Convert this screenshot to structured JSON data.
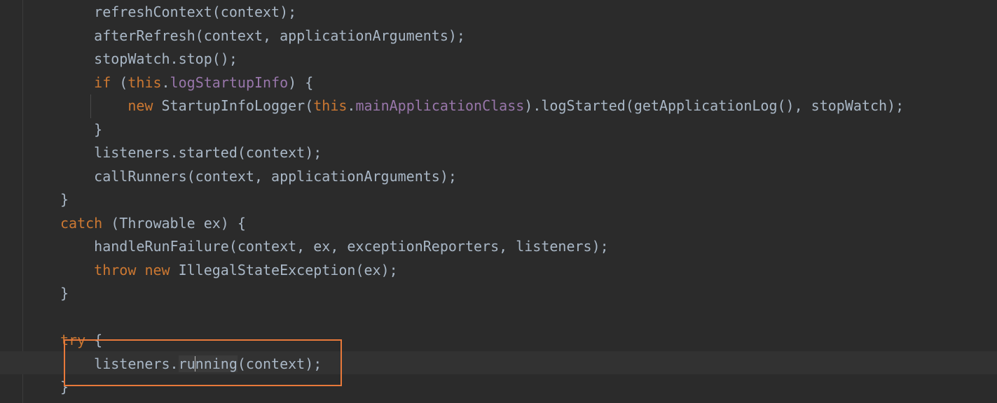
{
  "code": {
    "lines": [
      [
        {
          "t": "    refreshContext(context);",
          "c": "plain"
        }
      ],
      [
        {
          "t": "    afterRefresh(context, applicationArguments);",
          "c": "plain"
        }
      ],
      [
        {
          "t": "    stopWatch.stop();",
          "c": "plain"
        }
      ],
      [
        {
          "t": "    ",
          "c": "plain"
        },
        {
          "t": "if",
          "c": "kw"
        },
        {
          "t": " (",
          "c": "plain"
        },
        {
          "t": "this",
          "c": "kw"
        },
        {
          "t": ".",
          "c": "plain"
        },
        {
          "t": "logStartupInfo",
          "c": "fld"
        },
        {
          "t": ") {",
          "c": "plain"
        }
      ],
      [
        {
          "t": "        ",
          "c": "plain"
        },
        {
          "t": "new",
          "c": "kw"
        },
        {
          "t": " StartupInfoLogger(",
          "c": "plain"
        },
        {
          "t": "this",
          "c": "kw"
        },
        {
          "t": ".",
          "c": "plain"
        },
        {
          "t": "mainApplicationClass",
          "c": "fld"
        },
        {
          "t": ").logStarted(getApplicationLog(), stopWatch);",
          "c": "plain"
        }
      ],
      [
        {
          "t": "    }",
          "c": "plain"
        }
      ],
      [
        {
          "t": "    listeners.started(context);",
          "c": "plain"
        }
      ],
      [
        {
          "t": "    callRunners(context, applicationArguments);",
          "c": "plain"
        }
      ],
      [
        {
          "t": "}",
          "c": "plain"
        }
      ],
      [
        {
          "t": "catch",
          "c": "kw"
        },
        {
          "t": " (Throwable ex) {",
          "c": "plain"
        }
      ],
      [
        {
          "t": "    handleRunFailure(context, ex, exceptionReporters, listeners);",
          "c": "plain"
        }
      ],
      [
        {
          "t": "    ",
          "c": "plain"
        },
        {
          "t": "throw",
          "c": "kw"
        },
        {
          "t": " ",
          "c": "plain"
        },
        {
          "t": "new",
          "c": "kw"
        },
        {
          "t": " IllegalStateException(ex);",
          "c": "plain"
        }
      ],
      [
        {
          "t": "}",
          "c": "plain"
        }
      ],
      [],
      [
        {
          "t": "try",
          "c": "kw"
        },
        {
          "t": " {",
          "c": "plain"
        }
      ],
      [
        {
          "t": "    listeners.",
          "c": "plain"
        },
        {
          "t": "ru",
          "c": "word"
        },
        {
          "t": "",
          "c": "caret"
        },
        {
          "t": "nning",
          "c": "word"
        },
        {
          "t": "(context);",
          "c": "plain"
        }
      ],
      [
        {
          "t": "}",
          "c": "plain"
        }
      ]
    ],
    "current_line_index": 15
  },
  "colors": {
    "background": "#2b2b2b",
    "text": "#a9b7c6",
    "keyword": "#cc7832",
    "field": "#9876aa",
    "annotation_box": "#e8793a"
  }
}
